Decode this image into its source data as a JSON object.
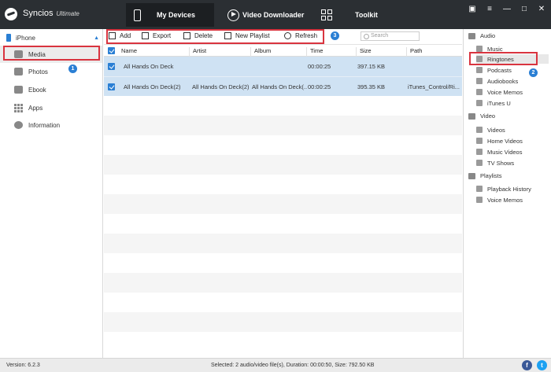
{
  "app": {
    "name": "Syncios",
    "edition": "Ultimate"
  },
  "nav": {
    "my_devices": "My Devices",
    "video_downloader": "Video Downloader",
    "toolkit": "Toolkit"
  },
  "window_controls": [
    "chat-icon",
    "menu-icon",
    "minimize-icon",
    "maximize-icon",
    "close-icon"
  ],
  "sidebar": {
    "device": "iPhone",
    "items": [
      {
        "label": "Media",
        "icon": "media-icon"
      },
      {
        "label": "Photos",
        "icon": "photos-icon"
      },
      {
        "label": "Ebook",
        "icon": "ebook-icon"
      },
      {
        "label": "Apps",
        "icon": "apps-icon"
      },
      {
        "label": "Information",
        "icon": "info-icon"
      }
    ]
  },
  "toolbar": {
    "add": "Add",
    "export": "Export",
    "delete": "Delete",
    "new_playlist": "New Playlist",
    "refresh": "Refresh",
    "search_placeholder": "Search"
  },
  "table": {
    "columns": [
      "Name",
      "Artist",
      "Album",
      "Time",
      "Size",
      "Path"
    ],
    "rows": [
      {
        "name": "All Hands On Deck",
        "artist": "",
        "album": "",
        "time": "00:00:25",
        "size": "397.15 KB",
        "path": ""
      },
      {
        "name": "All Hands On Deck(2)",
        "artist": "All Hands On Deck(2)",
        "album": "All Hands On Deck(...",
        "time": "00:00:25",
        "size": "395.35 KB",
        "path": "iTunes_Control/Ri..."
      }
    ]
  },
  "right_panel": {
    "audio": {
      "title": "Audio",
      "items": [
        "Music",
        "Ringtones",
        "Podcasts",
        "Audiobooks",
        "Voice Memos",
        "iTunes U"
      ]
    },
    "video": {
      "title": "Video",
      "items": [
        "Videos",
        "Home Videos",
        "Music Videos",
        "TV Shows"
      ]
    },
    "playlists": {
      "title": "Playlists",
      "items": [
        "Playback History",
        "Voice Memos"
      ]
    }
  },
  "status": {
    "version": "Version: 6.2.3",
    "summary": "Selected: 2 audio/video file(s), Duration: 00:00:50, Size: 792.50 KB"
  },
  "badges": {
    "one": "1",
    "two": "2",
    "three": "3"
  },
  "social": {
    "facebook": "f",
    "twitter": "t"
  },
  "colors": {
    "accent": "#2a7fd4",
    "highlight_box": "#d9343f",
    "titlebar": "#2b2f33",
    "selected_row": "#cfe2f3"
  }
}
